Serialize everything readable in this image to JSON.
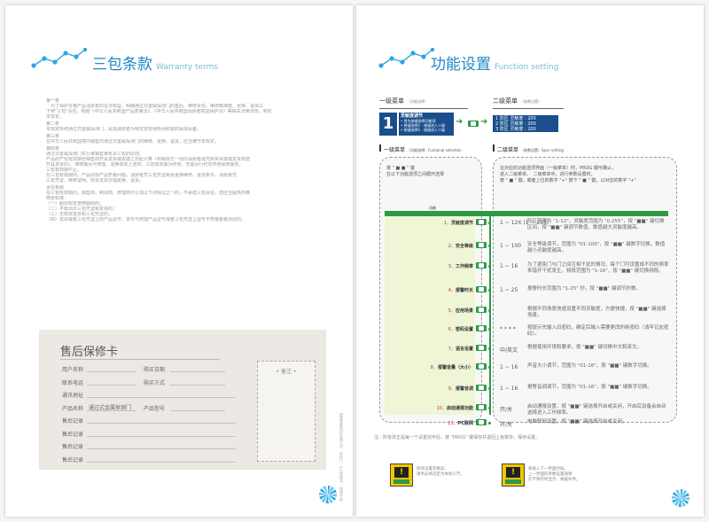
{
  "left": {
    "title": "三包条款",
    "title_en": "Warranty terms",
    "lines": [
      "第一条",
      "　为了保护合格产品消费者的合法权益，明确通过式金属探测门的售后、维修责任、维修精准度、更换、退货以",
      "下称\"三包\"责任，根据《中华人民共和国产品质量法》、《中华人民共和国消费者权益保护法》等相关法律法规，制定",
      "本规定。",
      "第二条",
      "本规定所称通过式金属探测门，是指消费者为特定安检场所而购置的探测设备。",
      "第三条",
      "在中华人民共和国境内销售的通过式金属探测门的维修、更换、退货，应当遵守本规定。",
      "第四条",
      "通过式金属探测门实行谁销售谁负责三包的原则。",
      "产品的产包有效期自销售商开具发票或收据之日起计算（购销双方一周内消费者需凭购买票据或发货单据",
      "开具发票的）。维修期间与修理、退换如非上述时，三包有效期为终身，无需另行约定终身保修服务。",
      "三包有效期中止。",
      "在三包有效期内，产品出现产品质量问题，消费者凭三包凭证免费更换维修、退货条件，消费者凭",
      "三包凭证、维修证明、购货发票办理更换、退货。",
      "责任免除",
      "在三包有效期内，销售商、制造商、修理商可以加以下列情况之一的，不承担三包责任，但应当提供的维",
      "修费标准：",
      "（一）超出规定使用期限的；",
      "（二）不能出示三包凭证和发票的；",
      "（三）无有效发票和三包凭证的；",
      "（四）发票或者三包凭证上的产品型号、货号与修理产品型号或者三包凭证上型号不符或者被涂改的。"
    ],
    "card": {
      "title": "售后保修卡",
      "fields": [
        {
          "l": "用户名称",
          "r": "购买日期"
        },
        {
          "l": "联系电话",
          "r": "购买方式"
        },
        {
          "l": "通讯地址",
          "r": ""
        },
        {
          "l": "产品名称",
          "r": "产品型号",
          "value": "通过式金属探测门"
        },
        {
          "l": "售后记录",
          "r": ""
        },
        {
          "l": "售后记录",
          "r": ""
        },
        {
          "l": "售后记录",
          "r": ""
        },
        {
          "l": "售后记录",
          "r": ""
        }
      ],
      "memo": "• 备注 •"
    },
    "spine": "德嘉智能科技有限公司 · 安检门 · 产品说明书 · 保修手册"
  },
  "right": {
    "title": "功能设置",
    "title_en": "Function setting",
    "menu1_label": "一级菜单",
    "menu1_small": "（功能选择）",
    "menu2_label": "二级菜单",
    "menu2_small": "（参数设置）",
    "menu1_num": "1",
    "menu1_box_title": "灵敏度调节",
    "menu1_box_lines": [
      "• 首先按键选择功能项",
      "• 按键选择1 - 按键进入二级",
      "• 按键选择1 - 按键进入二级"
    ],
    "menu2_box_lines": [
      "1 防区 灵敏度 : 200",
      "2 防区 灵敏度 : 200",
      "3 防区 灵敏度 : 200"
    ],
    "sec1": "一级菜单",
    "sec1_small": "（功能选择）Funtional selection",
    "sec2": "二级菜单",
    "sec2_small": "（参数设置）Spec setting",
    "note1": [
      "按 \" ■ ■ \" 键",
      "在以下功能选项之间循环选择"
    ],
    "note2": [
      "在对应的功能选项界面（一级菜单）时，PROG 键可确认，",
      "进入二级菜单。　二级菜单中，进行参数设置时，",
      "按 \" ■ \" 键，或者上位的数字 \"+\" 按下 \" ■ \" 键，以对应的数字 \"+\""
    ],
    "col_head": "功能",
    "rows": [
      {
        "n": "1、",
        "name": "灵敏度调节",
        "range": "1 ~ 12X\n(1 ~ 255)",
        "desc": "防区范围为 \"1-12\"，灵敏度范围为 \"0-255\"，按 \"■■\" 键切换区间，按 \"■■\" 键调节数值，数值越大灵敏度越高。"
      },
      {
        "n": "2、",
        "name": "安全等级",
        "range": "1 ~ 100",
        "desc": "安全等级调节，范围为 \"01-100\"，按 \"■■\" 键数字切换，数值越小灵敏度越高。"
      },
      {
        "n": "3、",
        "name": "工作频率",
        "range": "1 ~ 16",
        "desc": "为了避免门与门之间互相干扰的情况，每个门可设置成不同的频率来错开干扰发生，频段范围为 \"1-16\"，按 \"■■\" 键切换频段。"
      },
      {
        "n": "4、",
        "name": "报警时长",
        "range": "1 ~ 25",
        "desc": "报警时长范围为 \"1-25\" 秒，按 \"■■\" 键调节秒数。"
      },
      {
        "n": "5、",
        "name": "应用场景",
        "range": "",
        "desc": "根据不同场景快速设置不同灵敏度，方便快捷，按 \"■■\" 键选择场景。"
      },
      {
        "n": "6、",
        "name": "密码设置",
        "range": "* * * *",
        "desc": "按提示先输入旧密码，确定后输入需要更改的新密码（请牢记此密码）。"
      },
      {
        "n": "7、",
        "name": "语言设置",
        "range": "中/英文",
        "desc": "根据使用环境和要求，按 \"■■\" 键切换中文和英文。"
      },
      {
        "n": "8、",
        "name": "报警音量（大小）",
        "range": "1 ~ 16",
        "desc": "声音大小调节，范围为 \"01-16\"，按 \"■■\" 键数字切换。"
      },
      {
        "n": "9、",
        "name": "报警音调",
        "range": "1 ~ 16",
        "desc": "报警音调调节，范围为 \"01-16\"，按 \"■■\" 键数字切换。"
      },
      {
        "n": "10、",
        "name": "启动通报功能",
        "range": "开/关",
        "desc": "启动通报设置，按 \"■■\" 键选择开启或关闭，开启后设备会自动选择进入工作频率。"
      },
      {
        "n": "11、",
        "name": "PC联网",
        "range": "开/关",
        "desc": "电脑联网设置，按 \"■■\" 键选择开启或关闭。"
      }
    ],
    "footnote": "注：所有改正是每一个设置完毕后，按 \"PROG\" 键保存并返回上级菜单，保存设置。",
    "dev1_text": [
      "修改设置参数前，",
      "请务必将选定为本机小节。"
    ],
    "dev2_text": [
      "每进入下一界面时候，",
      "上一界面的参数设置值将",
      "在不保存时显示，根据条件。"
    ],
    "dev_screen": "!"
  },
  "colors": {
    "accent": "#1e88c7",
    "navy": "#1a4e8c",
    "green": "#2e9a46",
    "yellow": "#f2c800"
  }
}
